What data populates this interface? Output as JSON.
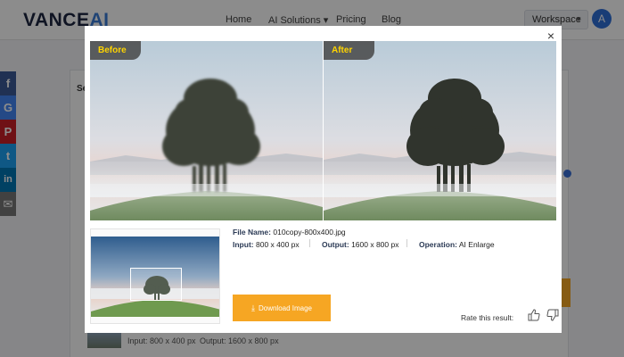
{
  "header": {
    "logo_main": "VANCE",
    "logo_ai": "AI",
    "nav": [
      "Home",
      "AI Solutions ▾",
      "Pricing",
      "Blog"
    ],
    "workspace_label": "Workspace",
    "avatar_letter": "A"
  },
  "background": {
    "section_label": "Se",
    "input_text": "Input: 800 x 400 px",
    "output_text": "Output: 1600 x 800 px"
  },
  "social": {
    "items": [
      {
        "icon": "facebook-icon",
        "glyph": "f",
        "color": "#3b5998"
      },
      {
        "icon": "google-icon",
        "glyph": "G",
        "color": "#4285f4"
      },
      {
        "icon": "pinterest-icon",
        "glyph": "P",
        "color": "#cb2027"
      },
      {
        "icon": "twitter-icon",
        "glyph": "t",
        "color": "#1da1f2"
      },
      {
        "icon": "linkedin-icon",
        "glyph": "in",
        "color": "#0077b5"
      },
      {
        "icon": "email-icon",
        "glyph": "✉",
        "color": "#777777"
      }
    ]
  },
  "modal": {
    "close_glyph": "×",
    "before_label": "Before",
    "after_label": "After",
    "file_name_label": "File Name:",
    "file_name_value": "010copy-800x400.jpg",
    "input_label": "Input:",
    "input_value": "800 x 400 px",
    "output_label": "Output:",
    "output_value": "1600 x 800 px",
    "operation_label": "Operation:",
    "operation_value": "AI Enlarge",
    "download_label": "Download Image",
    "rate_label": "Rate this result:"
  },
  "colors": {
    "accent_orange": "#f6a623",
    "tag_yellow": "#ffd400",
    "brand_blue": "#2f6fd8"
  }
}
